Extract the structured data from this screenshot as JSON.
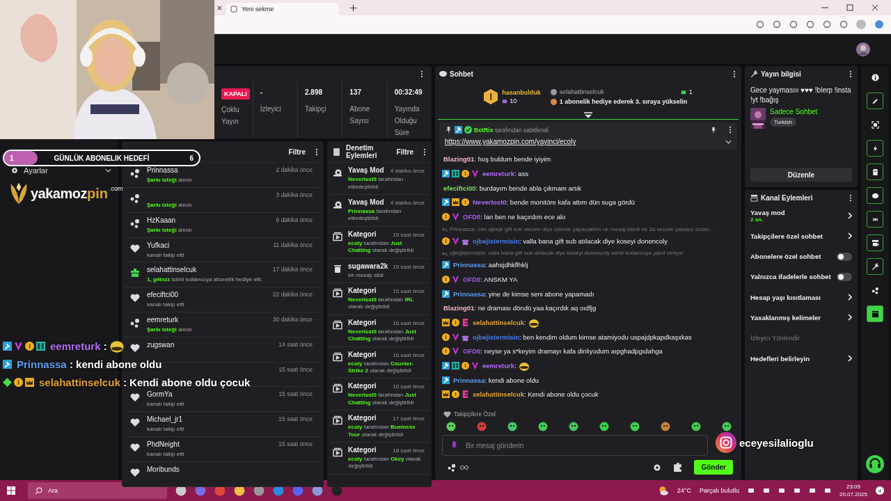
{
  "browser": {
    "tab_title": "Yeni sekme"
  },
  "sidebar": {
    "items": [
      {
        "label": "Ayarlar"
      }
    ]
  },
  "goal": {
    "current": "1",
    "title": "GÜNLÜK ABONELIK HEDEFİ",
    "target": "6",
    "level": 0.17
  },
  "logo": {
    "main": "yakamoz",
    "accent": "pin",
    "suffix": ".com"
  },
  "stats": {
    "status": "KAPALI",
    "status_label": "Çoklu Yayın",
    "items": [
      {
        "value": "-",
        "label": "İzleyici"
      },
      {
        "value": "2.898",
        "label": "Takipçi"
      },
      {
        "value": "137",
        "label": "Abone Sayısı"
      },
      {
        "value": "00:32:49",
        "label": "Yayında Olduğu Süre"
      }
    ]
  },
  "activity": {
    "filter": "Filtre",
    "items": [
      {
        "kind": "song",
        "name": "Prinnassa",
        "detail": [
          {
            "text": "Şarkı isteği",
            "highlight": true
          },
          {
            "text": " alındı",
            "highlight": false
          }
        ],
        "time": "2 dakika önce"
      },
      {
        "kind": "song",
        "detail": [
          {
            "text": "Şarkı isteği",
            "highlight": true
          },
          {
            "text": " alındı",
            "highlight": false
          }
        ],
        "time": "3 dakika önce"
      },
      {
        "kind": "song",
        "name": "HzKaaan",
        "detail": [
          {
            "text": "Şarkı isteği",
            "highlight": true
          },
          {
            "text": " alındı",
            "highlight": false
          }
        ],
        "time": "6 dakika önce"
      },
      {
        "kind": "follow",
        "name": "Yufkaci",
        "detail": [
          {
            "text": "kanalı takip etti",
            "highlight": false
          }
        ],
        "time": "11 dakika önce"
      },
      {
        "kind": "gift",
        "name": "selahattinselcuk",
        "detail": [
          {
            "text": "1, g4tezz",
            "highlight": true
          },
          {
            "text": " isimli kullanıcıya abonelik hediye etti.",
            "highlight": false
          }
        ],
        "time": "17 dakika önce"
      },
      {
        "kind": "follow",
        "name": "efeciftci00",
        "detail": [
          {
            "text": "kanalı takip etti",
            "highlight": false
          }
        ],
        "time": "22 dakika önce"
      },
      {
        "kind": "song",
        "name": "eemreturk",
        "detail": [
          {
            "text": "Şarkı isteği",
            "highlight": true
          },
          {
            "text": " alındı",
            "highlight": false
          }
        ],
        "time": "30 dakika önce"
      },
      {
        "kind": "follow",
        "name": "zugswan",
        "time": "14 saat önce"
      },
      {
        "time": "15 saat önce"
      },
      {
        "kind": "follow",
        "name": "GormYa",
        "detail": [
          {
            "text": "kanalı takip etti",
            "highlight": false
          }
        ],
        "time": "15 saat önce"
      },
      {
        "kind": "follow",
        "name": "Michael_jr1",
        "detail": [
          {
            "text": "kanalı takip etti",
            "highlight": false
          }
        ],
        "time": "15 saat önce"
      },
      {
        "kind": "follow",
        "name": "PhdNeight",
        "detail": [
          {
            "text": "kanalı takip etti",
            "highlight": false
          }
        ],
        "time": "15 saat önce"
      },
      {
        "kind": "follow",
        "name": "Moribunds"
      }
    ]
  },
  "moderation": {
    "title": "Denetim Eylemleri",
    "filter": "Filtre",
    "items": [
      {
        "kind": "slow",
        "title": "Yavaş Mod",
        "time": "4 dakika önce",
        "detail": [
          {
            "text": "Neverlost0",
            "highlight": true
          },
          {
            "text": " tarafından etkinleştirildi",
            "highlight": false
          }
        ]
      },
      {
        "kind": "slow",
        "title": "Yavaş Mod",
        "time": "4 dakika önce",
        "detail": [
          {
            "text": "Prinnassa",
            "highlight": true
          },
          {
            "text": " tarafından etkinleştirildi",
            "highlight": false
          }
        ]
      },
      {
        "kind": "category",
        "title": "Kategori",
        "time": "15 saat önce",
        "detail": [
          {
            "text": "ecoly",
            "highlight": true
          },
          {
            "text": " tarafından ",
            "highlight": false
          },
          {
            "text": "Just Chatting",
            "highlight": true
          },
          {
            "text": " olarak değiştirildi",
            "highlight": false
          }
        ]
      },
      {
        "kind": "delete",
        "title": "sugawara2k",
        "time": "15 saat önce",
        "detail": [
          {
            "text": "bir mesajı sildi",
            "highlight": false
          }
        ]
      },
      {
        "kind": "category",
        "title": "Kategori",
        "time": "15 saat önce",
        "detail": [
          {
            "text": "Neverlost0",
            "highlight": true
          },
          {
            "text": " tarafından ",
            "highlight": false
          },
          {
            "text": "IRL",
            "highlight": true
          },
          {
            "text": " olarak değiştirildi",
            "highlight": false
          }
        ]
      },
      {
        "kind": "category",
        "title": "Kategori",
        "time": "16 saat önce",
        "detail": [
          {
            "text": "Neverlost0",
            "highlight": true
          },
          {
            "text": " tarafından ",
            "highlight": false
          },
          {
            "text": "Just Chatting",
            "highlight": true
          },
          {
            "text": " olarak değiştirildi",
            "highlight": false
          }
        ]
      },
      {
        "kind": "category",
        "title": "Kategori",
        "time": "16 saat önce",
        "detail": [
          {
            "text": "ecoly",
            "highlight": true
          },
          {
            "text": " tarafından ",
            "highlight": false
          },
          {
            "text": "Counter-Strike 2",
            "highlight": true
          },
          {
            "text": " olarak değiştirildi",
            "highlight": false
          }
        ]
      },
      {
        "kind": "category",
        "title": "Kategori",
        "time": "16 saat önce",
        "detail": [
          {
            "text": "Neverlost0",
            "highlight": true
          },
          {
            "text": " tarafından ",
            "highlight": false
          },
          {
            "text": "Just Chatting",
            "highlight": true
          },
          {
            "text": " olarak değiştirildi",
            "highlight": false
          }
        ]
      },
      {
        "kind": "category",
        "title": "Kategori",
        "time": "17 saat önce",
        "detail": [
          {
            "text": "ecoly",
            "highlight": true
          },
          {
            "text": " tarafından ",
            "highlight": false
          },
          {
            "text": "Business Tour",
            "highlight": true
          },
          {
            "text": " olarak değiştirildi",
            "highlight": false
          }
        ]
      },
      {
        "kind": "category",
        "title": "Kategori",
        "time": "18 saat önce",
        "detail": [
          {
            "text": "ecoly",
            "highlight": true
          },
          {
            "text": " tarafından ",
            "highlight": false
          },
          {
            "text": "Okey",
            "highlight": true
          },
          {
            "text": " olarak değiştirildi",
            "highlight": false
          }
        ]
      }
    ]
  },
  "chat": {
    "title": "Sohbet",
    "leader": {
      "name": "hasanbulduk",
      "count": "10",
      "second_name": "selahattinselcuk",
      "second_count": "1",
      "hint": "1 abonelik hediye ederek 3. sıraya yükselin"
    },
    "pinned": {
      "by": "BotRix",
      "by_text": "tarafından sabitlendi",
      "link": "https://www.yakamozpin.com/yayinci/ecoly"
    },
    "messages": [
      {
        "kind": "text",
        "user": "Blazing01",
        "color": "#f2b8c6",
        "text": ": hoş buldum bende iyiyim"
      },
      {
        "kind": "text",
        "user": "eemreturk",
        "color": "#b46cf2",
        "badges": [
          {
            "kind": "mod"
          },
          {
            "kind": "gg"
          },
          {
            "kind": "one"
          },
          {
            "kind": "v"
          }
        ],
        "text": ": ass"
      },
      {
        "kind": "text",
        "user": "efeciftci00",
        "color": "#7fe05a",
        "text": ": burdayım bende abla çıkmam artık"
      },
      {
        "kind": "text",
        "user": "Neverlost0",
        "color": "#a86cf6",
        "badges": [
          {
            "kind": "mod"
          },
          {
            "kind": "crown"
          },
          {
            "kind": "one"
          }
        ],
        "text": ": bende monitöre kafa attım dün suga gördü"
      },
      {
        "kind": "text",
        "user": "OFD0",
        "color": "#a25cf2",
        "badges": [
          {
            "kind": "one"
          },
          {
            "kind": "v"
          }
        ],
        "text": ": lan ben ne kaçırdım ece alo"
      },
      {
        "kind": "text",
        "user": "ojbejistermisin",
        "color": "#3f7df2",
        "badges": [
          {
            "kind": "one"
          },
          {
            "kind": "v"
          },
          {
            "kind": "gift"
          }
        ],
        "text": ": valla bana gift sub atılacak diye koseyi donencoly",
        "reply": "Prinnassa: olm ojbeje gift sub atıcam diye ödeme yapacaktım ne mesaj istedi ne 3d secure şakasız dolan..."
      },
      {
        "kind": "text",
        "user": "Prinnassa",
        "color": "#5c9df2",
        "badges": [
          {
            "kind": "mod"
          }
        ],
        "text": ": aahsjdhkflhklj",
        "reply": "ojbejistermisin: valla bana gift sub atılacak diye koseyi donencoly isimli kullanıcıya yanıt veriyor"
      },
      {
        "kind": "text",
        "user": "OFD0",
        "color": "#a25cf2",
        "badges": [
          {
            "kind": "one"
          },
          {
            "kind": "v"
          }
        ],
        "text": ": ANSKM YA"
      },
      {
        "kind": "text",
        "user": "Prinnassa",
        "color": "#5c9df2",
        "badges": [
          {
            "kind": "mod"
          }
        ],
        "text": ": yine de kimse seni abone yapamadı"
      },
      {
        "kind": "text",
        "user": "Blazing01",
        "color": "#f2b8c6",
        "text": ": ne draması döndü yaa kaçırdık aq oıdfjg"
      },
      {
        "kind": "emote",
        "user": "selahattinselcuk",
        "color": "#e2a232",
        "badges": [
          {
            "kind": "crown"
          },
          {
            "kind": "one"
          },
          {
            "kind": "e"
          }
        ],
        "text": ":"
      },
      {
        "kind": "text",
        "user": "ojbejistermisin",
        "color": "#3f7df2",
        "badges": [
          {
            "kind": "one"
          },
          {
            "kind": "v"
          },
          {
            "kind": "gift"
          }
        ],
        "text": ": ben kendim oldum kimse atamiyodu uspajdpkapdkaşxkas"
      },
      {
        "kind": "text",
        "user": "OFD0",
        "color": "#a25cf2",
        "badges": [
          {
            "kind": "one"
          },
          {
            "kind": "v"
          }
        ],
        "text": ": neyse ya s*keyim dramayı kafa dinliyodum aıpghadpgıdahga"
      },
      {
        "kind": "emote",
        "user": "eemreturk",
        "color": "#b46cf2",
        "badges": [
          {
            "kind": "mod"
          },
          {
            "kind": "gg"
          },
          {
            "kind": "one"
          },
          {
            "kind": "v"
          }
        ],
        "text": ":"
      },
      {
        "kind": "text",
        "user": "Prinnassa",
        "color": "#5c9df2",
        "badges": [
          {
            "kind": "mod"
          }
        ],
        "text": ": kendi abone oldu"
      },
      {
        "kind": "text",
        "user": "selahattinselcuk",
        "color": "#e2a232",
        "badges": [
          {
            "kind": "crown"
          },
          {
            "kind": "one"
          },
          {
            "kind": "e"
          }
        ],
        "text": ": Kendi abone oldu çocuk"
      }
    ],
    "emote_set": "Takipçilere Özel",
    "placeholder": "Bir mesaj gönderin",
    "send": "Gönder"
  },
  "overlay_chat": [
    {
      "user": "eemreturk",
      "color": "#b46cf2",
      "badges": [
        {
          "kind": "mod"
        },
        {
          "kind": "v"
        },
        {
          "kind": "one"
        },
        {
          "kind": "gg"
        }
      ],
      "kind": "emote",
      "text": ":"
    },
    {
      "user": "Prinnassa",
      "color": "#5c9df2",
      "badges": [
        {
          "kind": "mod"
        }
      ],
      "kind": "text",
      "text": ": kendi abone oldu"
    },
    {
      "user": "selahattinselcuk",
      "color": "#e2a232",
      "badges": [
        {
          "kind": "diamond"
        },
        {
          "kind": "one"
        },
        {
          "kind": "crown"
        }
      ],
      "kind": "text",
      "text": ": Kendi abone oldu çocuk"
    }
  ],
  "instagram": {
    "handle": "eceyesilalioglu"
  },
  "stream_info": {
    "title": "Yayın bilgisi",
    "description": "Gece yaymasııı ♥♥♥ !blerp !insta !yt !bağış",
    "category": "Sadece Sohbet",
    "tag": "Turkish",
    "edit": "Düzenle"
  },
  "channel_actions": {
    "title": "Kanal Eylemleri",
    "items": [
      {
        "kind": "link",
        "label": "Yavaş mod",
        "sub": "2 sn."
      },
      {
        "kind": "link",
        "label": "Takipçilere özel sohbet"
      },
      {
        "kind": "toggle",
        "label": "Abonelere özel sohbet",
        "on": false
      },
      {
        "kind": "toggle",
        "label": "Yalnızca ifadelerle sohbet",
        "on": false
      },
      {
        "kind": "link",
        "label": "Hesap yaşı kısıtlaması"
      },
      {
        "kind": "link",
        "label": "Yasaklanmış kelimeler"
      },
      {
        "kind": "disabled",
        "label": "İzleyici Yönlendir"
      },
      {
        "kind": "link",
        "label": "Hedefleri belirleyin"
      }
    ]
  },
  "rail": [
    {
      "kind": "info",
      "on": false
    },
    {
      "kind": "pencil",
      "on": true
    },
    {
      "kind": "scan",
      "on": false
    },
    {
      "kind": "bolt",
      "on": true
    },
    {
      "kind": "doc",
      "on": true
    },
    {
      "kind": "chat",
      "on": true
    },
    {
      "kind": "broadcast",
      "on": true
    },
    {
      "kind": "camera",
      "on": true
    },
    {
      "kind": "wrench",
      "on": true
    },
    {
      "kind": "dots",
      "on": false
    },
    {
      "kind": "clapper",
      "on": true
    }
  ],
  "taskbar": {
    "search": "Ara",
    "temperature": "24°C",
    "weather": "Parçalı bulutlu",
    "time": "23:05",
    "date": "20.07.2025",
    "notifications": "4"
  }
}
